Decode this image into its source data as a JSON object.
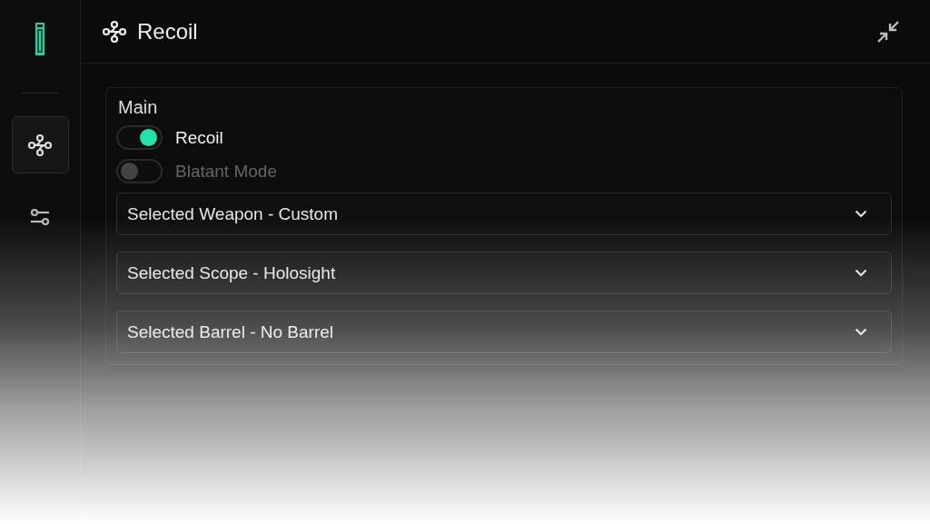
{
  "sidebar": {
    "items": [
      {
        "kind": "recoil",
        "selected": true
      },
      {
        "kind": "sliders",
        "selected": false
      }
    ]
  },
  "header": {
    "title": "Recoil"
  },
  "section": {
    "title": "Main",
    "toggles": [
      {
        "label": "Recoil",
        "on": true
      },
      {
        "label": "Blatant Mode",
        "on": false
      }
    ],
    "dropdowns": [
      {
        "value": "Selected Weapon - Custom"
      },
      {
        "value": "Selected Scope - Holosight"
      },
      {
        "value": "Selected Barrel - No Barrel"
      }
    ]
  }
}
